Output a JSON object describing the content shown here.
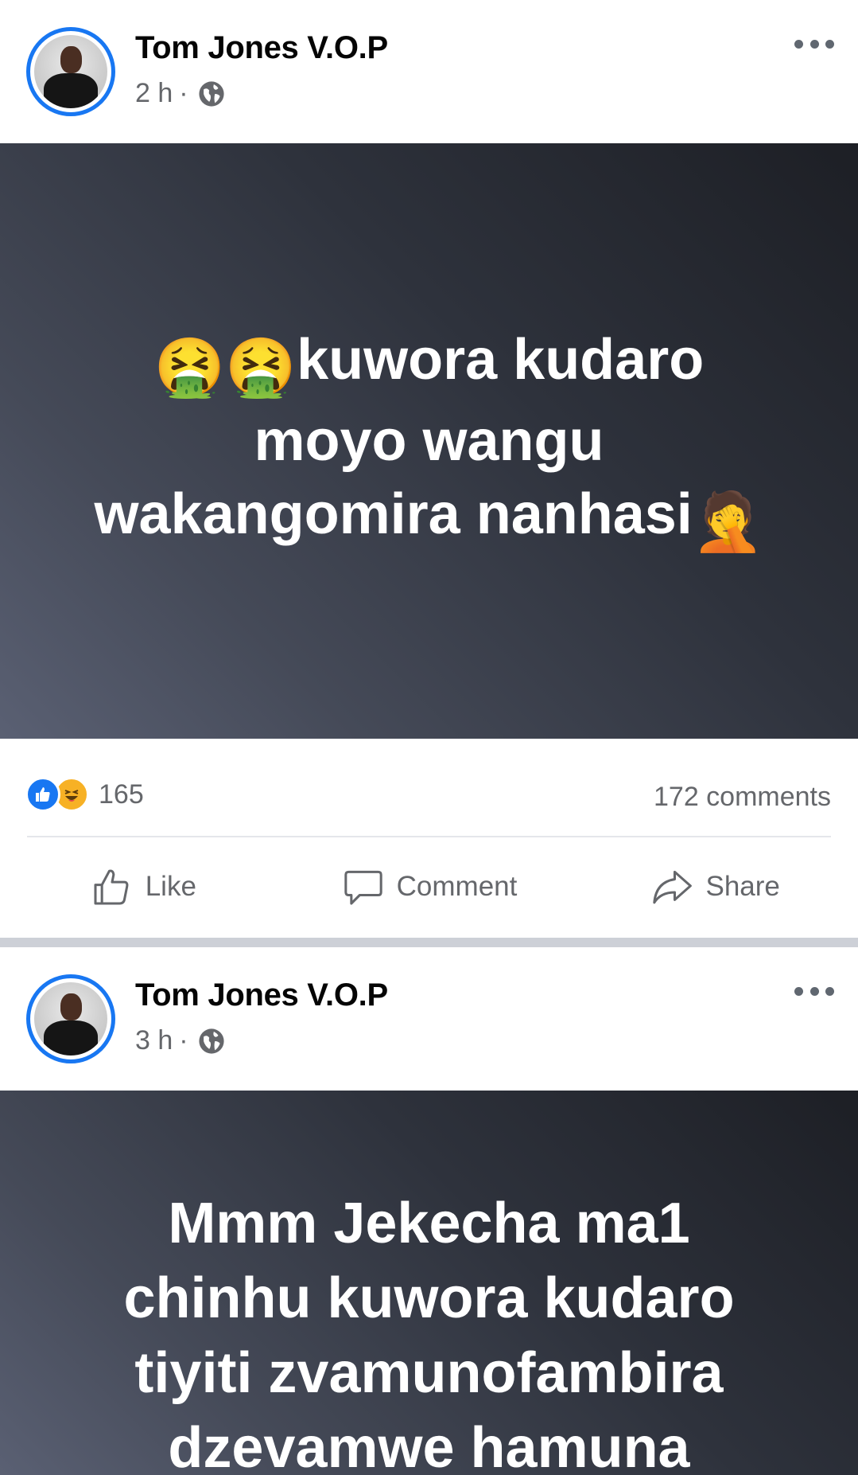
{
  "posts": [
    {
      "author": "Tom Jones V.O.P",
      "time": "2 h",
      "meta_sep": "·",
      "audience_icon": "globe-icon",
      "text": "kuwora kudaro moyo wangu wakangomira nanhasi",
      "text_line1": "kuwora kudaro",
      "text_line2": "moyo wangu",
      "text_line3": "wakangomira nanhasi",
      "leading_emojis": "🤮🤮",
      "trailing_emoji": "🤦",
      "reaction_count": "165",
      "reactions": [
        "like",
        "haha"
      ],
      "comments": "172 comments",
      "actions": {
        "like": "Like",
        "comment": "Comment",
        "share": "Share"
      }
    },
    {
      "author": "Tom Jones V.O.P",
      "time": "3 h",
      "meta_sep": "·",
      "audience_icon": "globe-icon",
      "text_line1": "Mmm Jekecha ma1",
      "text_line2": "chinhu kuwora kudaro",
      "text_line3": "tiyiti zvamunofambira",
      "text_line4": "dzevamwe hamuna"
    }
  ],
  "colors": {
    "accent": "#1877f2",
    "secondary_text": "#65676b",
    "separator": "#cdd0d7"
  }
}
